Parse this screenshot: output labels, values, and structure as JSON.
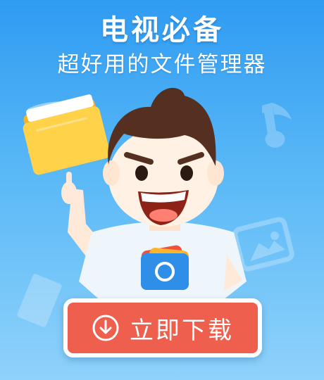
{
  "banner": {
    "title": "电视必备",
    "subtitle": "超好用的文件管理器"
  },
  "cta": {
    "label": "立即下载",
    "icon": "download-circle-icon"
  },
  "colors": {
    "background_top": "#2f9bf2",
    "background_bottom": "#8fd2fb",
    "cta_fill": "#ee5f4d",
    "cta_border": "#ffffff"
  }
}
